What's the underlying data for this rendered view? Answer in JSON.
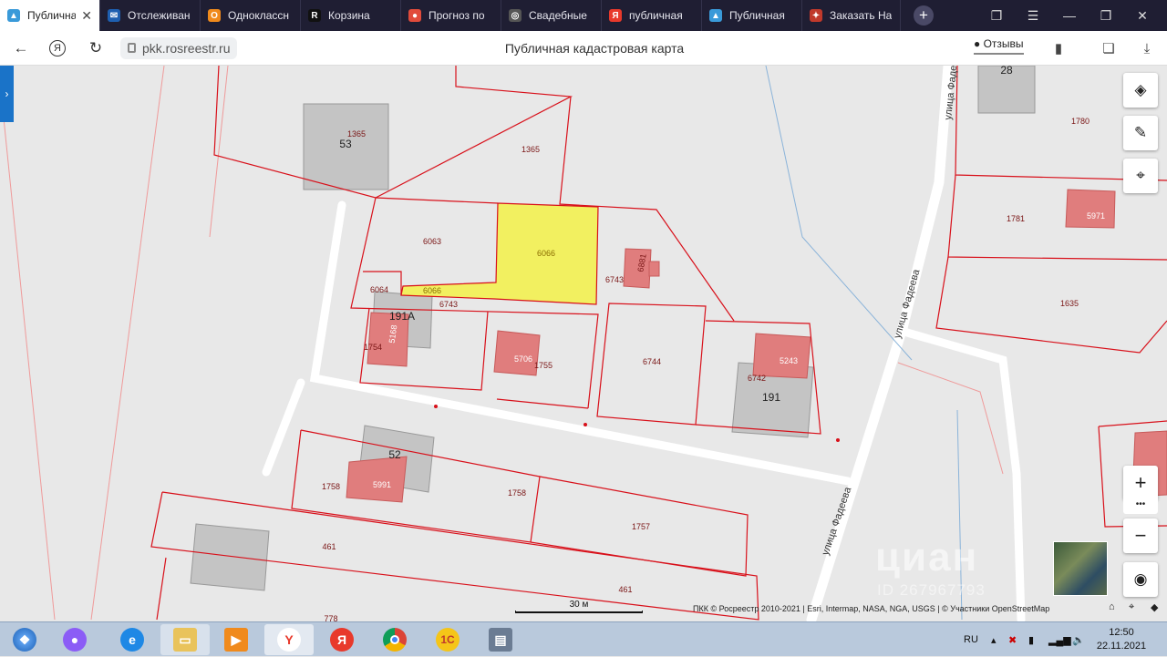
{
  "tabs": [
    {
      "label": "Публичная",
      "color": "#3a9ad9",
      "glyph": "▲",
      "active": true
    },
    {
      "label": "Отслеживан",
      "color": "#1e5fb0",
      "glyph": "✉"
    },
    {
      "label": "Одноклассн",
      "color": "#f08a1c",
      "glyph": "О"
    },
    {
      "label": "Корзина",
      "color": "#111111",
      "glyph": "R"
    },
    {
      "label": "Прогноз по",
      "color": "#e14b3b",
      "glyph": "●"
    },
    {
      "label": "Свадебные",
      "color": "#555555",
      "glyph": "◎"
    },
    {
      "label": "публичная",
      "color": "#e8392b",
      "glyph": "Я"
    },
    {
      "label": "Публичная",
      "color": "#3a9ad9",
      "glyph": "▲"
    },
    {
      "label": "Заказать На",
      "color": "#c0392b",
      "glyph": "✦"
    }
  ],
  "address": {
    "url": "pkk.rosreestr.ru",
    "title": "Публичная кадастровая карта",
    "reviews": "Отзывы"
  },
  "map": {
    "parcel_labels": [
      {
        "text": "1365"
      },
      {
        "text": "53"
      },
      {
        "text": "1365"
      },
      {
        "text": "6063"
      },
      {
        "text": "6066"
      },
      {
        "text": "6066"
      },
      {
        "text": "6064"
      },
      {
        "text": "6743"
      },
      {
        "text": "6743"
      },
      {
        "text": "6881"
      },
      {
        "text": "191А"
      },
      {
        "text": "5168"
      },
      {
        "text": "1754"
      },
      {
        "text": "5706"
      },
      {
        "text": "1755"
      },
      {
        "text": "6744"
      },
      {
        "text": "5243"
      },
      {
        "text": "6742"
      },
      {
        "text": "191"
      },
      {
        "text": "52"
      },
      {
        "text": "1758"
      },
      {
        "text": "5991"
      },
      {
        "text": "1758"
      },
      {
        "text": "1757"
      },
      {
        "text": "461"
      },
      {
        "text": "461"
      },
      {
        "text": "778"
      },
      {
        "text": "28"
      },
      {
        "text": "1780"
      },
      {
        "text": "1781"
      },
      {
        "text": "5971"
      },
      {
        "text": "1635"
      }
    ],
    "street_1": "улица Фадеева",
    "street_2": "улица Фадеева",
    "street_3": "улица Фадеева",
    "scale_label": "30 м",
    "attribution": "ПКК © Росреестр 2010-2021 | Esri, Intermap, NASA, NGA, USGS | © Участники OpenStreetMap",
    "watermark": "циан",
    "watermark_id": "ID 267967793",
    "colors": {
      "parcel_border": "#d8101a",
      "selected_fill": "#f2f060",
      "building_fill": "#e07d7d",
      "structure_fill": "#c4c4c4"
    }
  },
  "controls": {
    "layers_icon": "layers-icon",
    "ruler_icon": "ruler-icon",
    "locate_icon": "crosshair-icon",
    "zoom_in": "+",
    "zoom_dots": "•••",
    "zoom_out": "−"
  },
  "taskbar": {
    "lang": "RU",
    "time": "12:50",
    "date": "22.11.2021"
  }
}
